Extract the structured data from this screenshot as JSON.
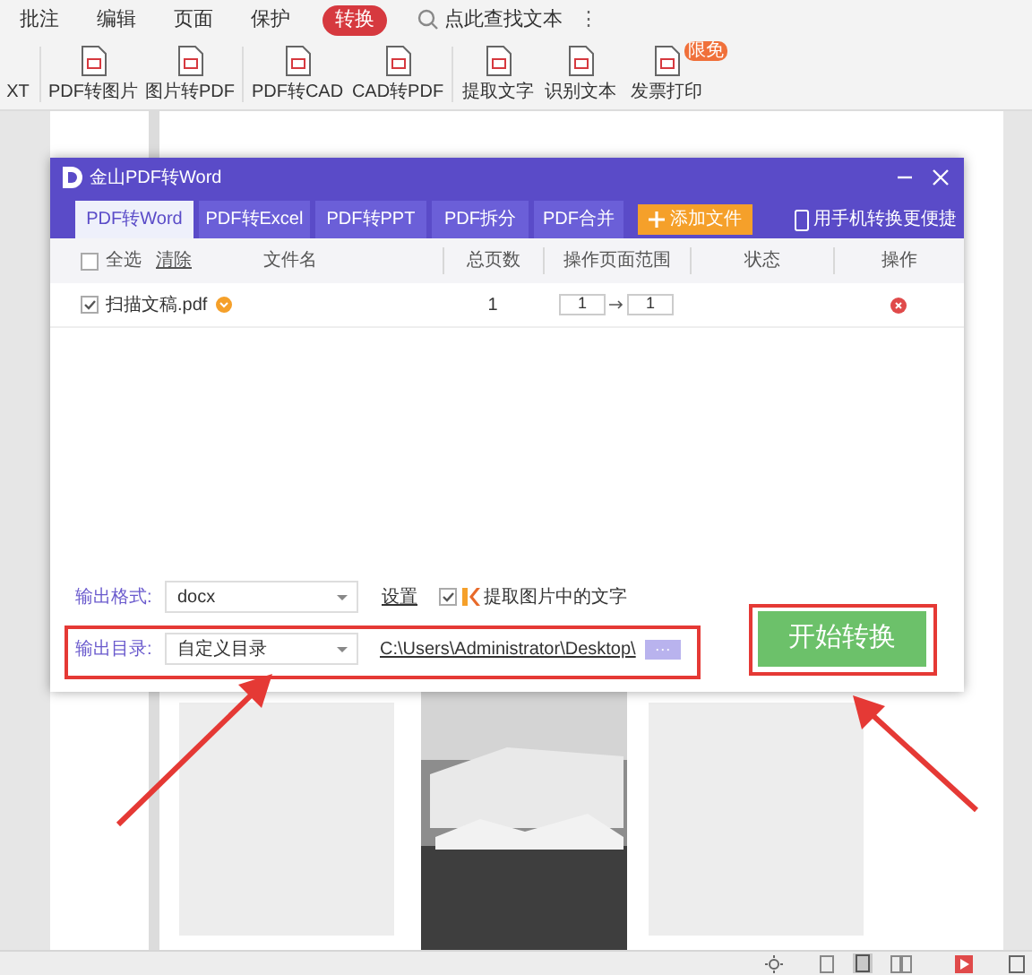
{
  "menu_tabs": [
    {
      "label": "批注",
      "selected": false
    },
    {
      "label": "编辑",
      "selected": false
    },
    {
      "label": "页面",
      "selected": false
    },
    {
      "label": "保护",
      "selected": false
    },
    {
      "label": "转换",
      "selected": true
    }
  ],
  "search": {
    "placeholder": "点此查找文本"
  },
  "more": "⋮",
  "toolbar": [
    {
      "kind": "cut",
      "label": "XT"
    },
    {
      "kind": "tool",
      "label": "PDF转图片"
    },
    {
      "kind": "tool",
      "label": "图片转PDF"
    },
    {
      "kind": "tool",
      "label": "PDF转CAD"
    },
    {
      "kind": "tool",
      "label": "CAD转PDF"
    },
    {
      "kind": "tool",
      "label": "提取文字"
    },
    {
      "kind": "tool",
      "label": "识别文本"
    },
    {
      "kind": "tool",
      "label": "发票打印",
      "badge": "限免"
    }
  ],
  "dialog": {
    "title": "金山PDF转Word",
    "tabs": [
      {
        "label": "PDF转Word",
        "selected": true
      },
      {
        "label": "PDF转Excel",
        "selected": false
      },
      {
        "label": "PDF转PPT",
        "selected": false
      },
      {
        "label": "PDF拆分",
        "selected": false
      },
      {
        "label": "PDF合并",
        "selected": false
      }
    ],
    "add_button": "添加文件",
    "mobile_link": "用手机转换更便捷",
    "select_all": {
      "label": "全选",
      "checked": false
    },
    "clear": "清除",
    "columns": [
      "文件名",
      "总页数",
      "操作页面范围",
      "状态",
      "操作"
    ],
    "rows": [
      {
        "checked": true,
        "name": "扫描文稿.pdf",
        "pages": "1",
        "range_from": "1",
        "range_to": "1"
      }
    ],
    "output_format": {
      "label": "输出格式:",
      "value": "docx"
    },
    "settings_link": "设置",
    "ocr": {
      "label": "提取图片中的文字",
      "checked": true
    },
    "output_dir": {
      "label": "输出目录:",
      "value": "自定义目录",
      "path": "C:\\Users\\Administrator\\Desktop\\",
      "browse": "···"
    },
    "start_button": "开始转换"
  }
}
